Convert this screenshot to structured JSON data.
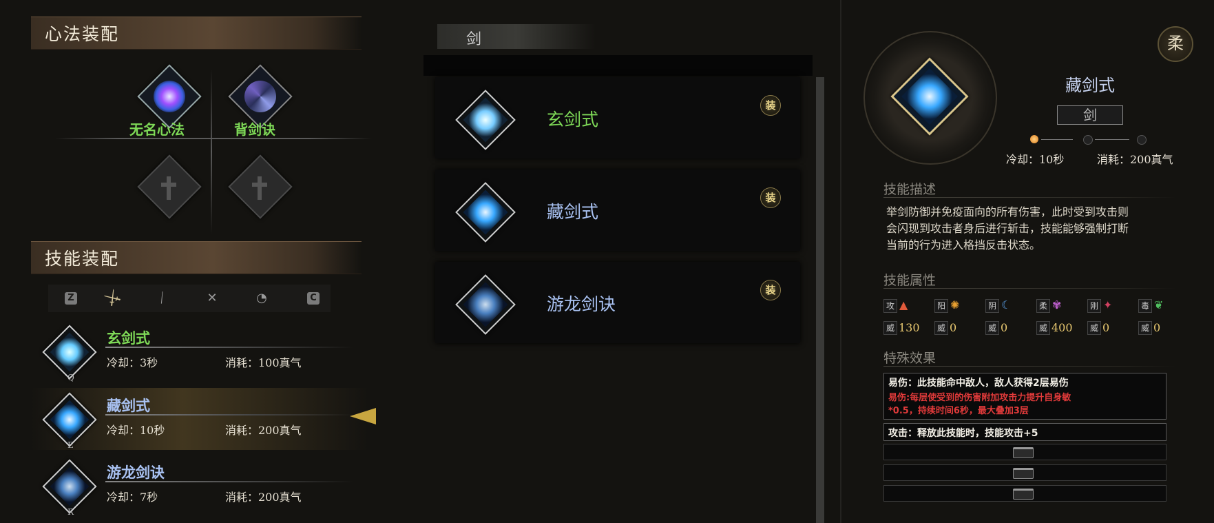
{
  "left": {
    "heart_title": "心法装配",
    "hearts": [
      {
        "name": "无名心法",
        "equipped": true
      },
      {
        "name": "背剑诀",
        "equipped": true
      },
      {
        "name": "",
        "equipped": false
      },
      {
        "name": "",
        "equipped": false
      }
    ],
    "skill_title": "技能装配",
    "tabs": [
      {
        "icon": "z-key-icon",
        "label": "Z"
      },
      {
        "icon": "sword-icon",
        "label": ""
      },
      {
        "icon": "saber-icon",
        "label": ""
      },
      {
        "icon": "dual-blades-icon",
        "label": ""
      },
      {
        "icon": "fan-icon",
        "label": ""
      },
      {
        "icon": "c-key-icon",
        "label": "C"
      }
    ],
    "skills": [
      {
        "key": "Q",
        "name": "玄剑式",
        "cooldown": "冷却：3秒",
        "cost": "消耗：100真气",
        "color": "#7ed957"
      },
      {
        "key": "E",
        "name": "藏剑式",
        "cooldown": "冷却：10秒",
        "cost": "消耗：200真气",
        "color": "#a9c2f2"
      },
      {
        "key": "R",
        "name": "游龙剑诀",
        "cooldown": "冷却：7秒",
        "cost": "消耗：200真气",
        "color": "#a9c2f2"
      }
    ]
  },
  "middle": {
    "category": "剑",
    "cards": [
      {
        "name": "玄剑式",
        "badge": "装",
        "color": "#7ed957"
      },
      {
        "name": "藏剑式",
        "badge": "装",
        "color": "#a9c2f2"
      },
      {
        "name": "游龙剑诀",
        "badge": "装",
        "color": "#a9c2f2"
      }
    ]
  },
  "right": {
    "style_badge": "柔",
    "skill_name": "藏剑式",
    "weapon_type": "剑",
    "level_dots": [
      true,
      false,
      false
    ],
    "cooldown": "冷却：10秒",
    "cost": "消耗：200真气",
    "desc_title": "技能描述",
    "desc_lines": [
      "举剑防御并免疫面向的所有伤害，此时受到攻击则",
      "会闪现到攻击者身后进行斩击，技能能够强制打断",
      "当前的行为进入格挡反击状态。"
    ],
    "attr_title": "技能属性",
    "attributes": [
      {
        "label": "攻",
        "value_label": "威",
        "value": "130",
        "color": "#e05a3a",
        "glyph": "▲"
      },
      {
        "label": "阳",
        "value_label": "威",
        "value": "0",
        "color": "#e8a030",
        "glyph": "✺"
      },
      {
        "label": "阴",
        "value_label": "威",
        "value": "0",
        "color": "#5aa0e8",
        "glyph": "☾"
      },
      {
        "label": "柔",
        "value_label": "威",
        "value": "400",
        "color": "#c060d0",
        "glyph": "✾"
      },
      {
        "label": "刚",
        "value_label": "威",
        "value": "0",
        "color": "#d04060",
        "glyph": "✦"
      },
      {
        "label": "毒",
        "value_label": "威",
        "value": "0",
        "color": "#50c060",
        "glyph": "❦"
      }
    ],
    "effect_title": "特殊效果",
    "effects": [
      {
        "main": "易伤：此技能命中敌人，敌人获得2层易伤",
        "detail": [
          "易伤:每层使受到的伤害附加攻击力提升自身敏",
          "*0.5，持续时间6秒，最大叠加3层"
        ]
      },
      {
        "main": "攻击：释放此技能时，技能攻击+5",
        "detail": []
      }
    ],
    "empty_slots": 3
  }
}
